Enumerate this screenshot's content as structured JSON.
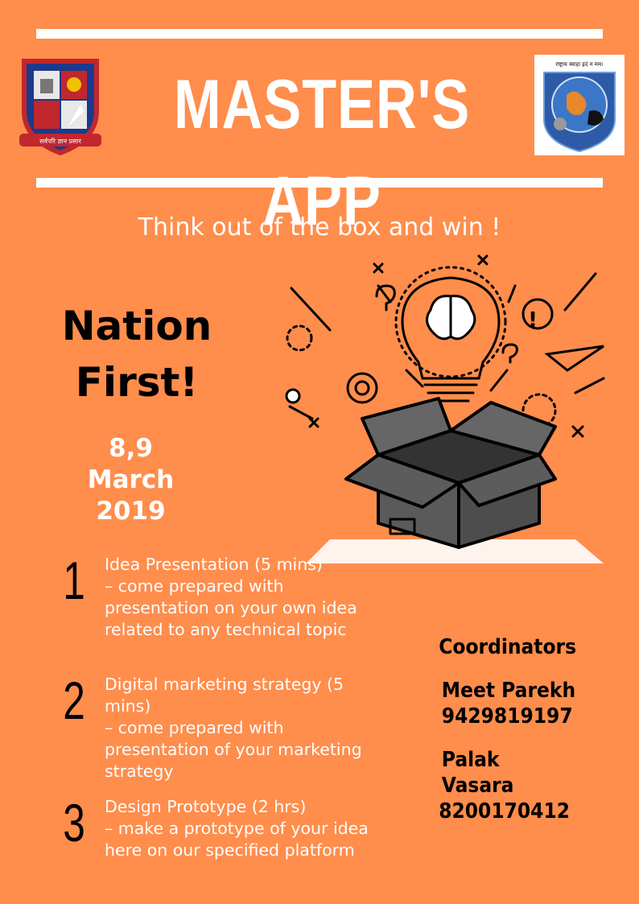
{
  "header": {
    "title": "MASTER'S APP",
    "left_logo_text": "GUJARAT TECHNOLOGICAL UNIVERSITY",
    "right_logo_text": "राष्ट्राय स्वाहा इदं न मम।"
  },
  "tagline": "Think out of the box and win !",
  "slogan": {
    "line1": "Nation",
    "line2": "First!"
  },
  "date": {
    "line1": "8,9",
    "line2": "March",
    "line3": "2019"
  },
  "events": [
    {
      "num": "1",
      "lines": [
        "Idea Presentation (5 mins)",
        "– come prepared with",
        "presentation on your own idea",
        "related to any technical topic"
      ]
    },
    {
      "num": "2",
      "lines": [
        "Digital marketing strategy (5",
        "mins)",
        "– come prepared with",
        "presentation of your marketing",
        "strategy"
      ]
    },
    {
      "num": "3",
      "lines": [
        "Design Prototype (2 hrs)",
        "– make a prototype of your idea",
        "here on our specified platform"
      ]
    }
  ],
  "coordinators": {
    "heading": "Coordinators",
    "people": [
      {
        "name": "Meet Parekh",
        "phone": "9429819197"
      },
      {
        "name": "Palak Vasara",
        "phone": "8200170412"
      }
    ]
  },
  "colors": {
    "background": "#ff8d4c",
    "text_light": "#ffffff",
    "text_dark": "#000000",
    "box": "#4d4d4d"
  },
  "icons": [
    "university-crest-icon",
    "emblem-logo-icon",
    "brain-lightbulb-icon",
    "open-box-icon"
  ]
}
